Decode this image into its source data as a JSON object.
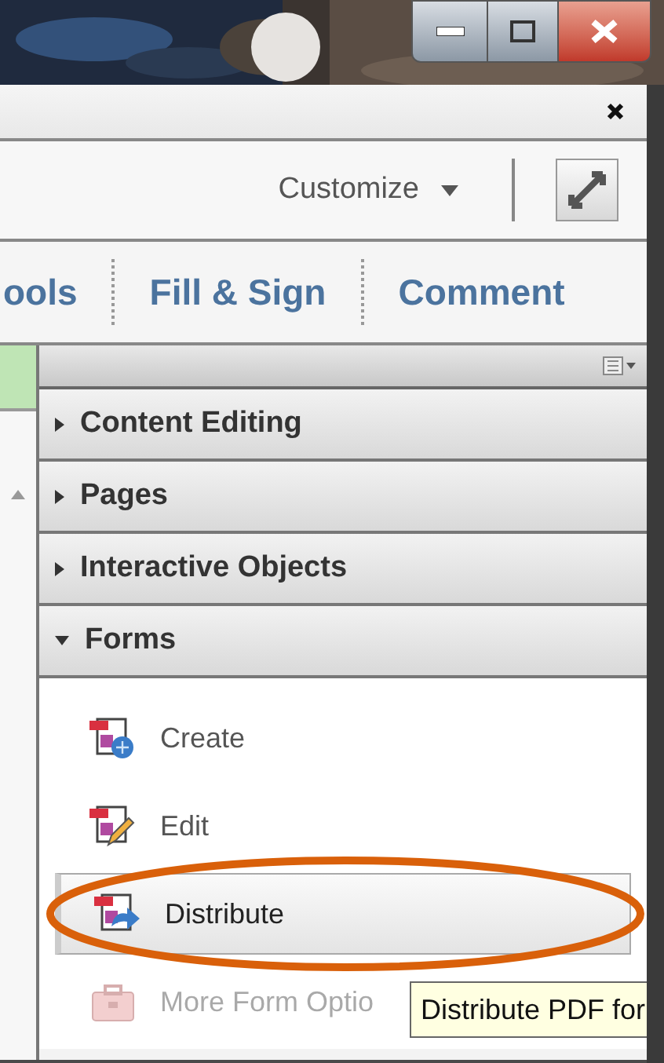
{
  "toolbar": {
    "customize": "Customize"
  },
  "tabs": [
    {
      "label": "ools"
    },
    {
      "label": "Fill & Sign"
    },
    {
      "label": "Comment"
    }
  ],
  "sections": [
    {
      "label": "Content Editing",
      "expanded": false
    },
    {
      "label": "Pages",
      "expanded": false
    },
    {
      "label": "Interactive Objects",
      "expanded": false
    },
    {
      "label": "Forms",
      "expanded": true,
      "items": [
        {
          "label": "Create",
          "kind": "create",
          "selected": false,
          "disabled": false
        },
        {
          "label": "Edit",
          "kind": "edit",
          "selected": false,
          "disabled": false
        },
        {
          "label": "Distribute",
          "kind": "distribute",
          "selected": true,
          "disabled": false
        },
        {
          "label": "More Form Optio",
          "kind": "more",
          "selected": false,
          "disabled": true
        }
      ]
    }
  ],
  "tooltip": {
    "text": "Distribute PDF for"
  }
}
